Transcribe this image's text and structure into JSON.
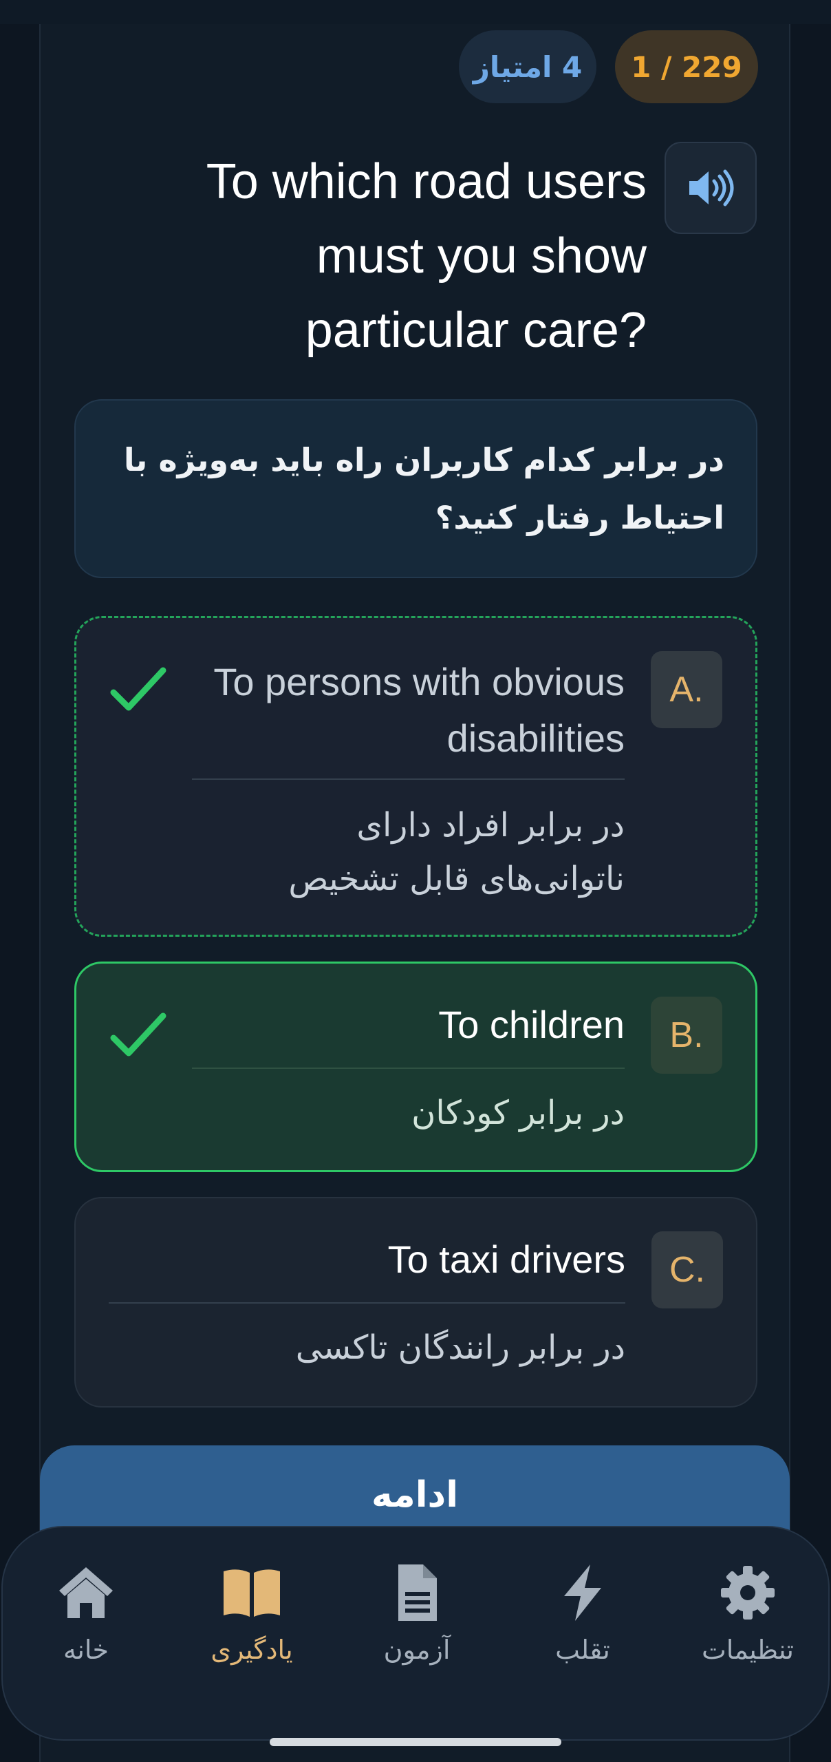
{
  "header": {
    "progress": "1 / 229",
    "score": "4 امتیاز"
  },
  "question": {
    "english": "To which road users must you show particular care?",
    "persian": "در برابر کدام کاربران راه باید به‌ویژه با احتیاط رفتار کنید؟"
  },
  "options": [
    {
      "letter": "A.",
      "english": "To persons with obvious disabilities",
      "persian": "در برابر افراد دارای ناتوانی‌های قابل تشخیص",
      "state": "correct-unselected"
    },
    {
      "letter": "B.",
      "english": "To children",
      "persian": "در برابر کودکان",
      "state": "correct-selected"
    },
    {
      "letter": "C.",
      "english": "To taxi drivers",
      "persian": "در برابر رانندگان تاکسی",
      "state": "neutral"
    }
  ],
  "continue_label": "ادامه",
  "nav": {
    "items": [
      {
        "label": "خانه",
        "icon": "home-icon"
      },
      {
        "label": "یادگیری",
        "icon": "book-icon",
        "active": true
      },
      {
        "label": "آزمون",
        "icon": "document-icon"
      },
      {
        "label": "تقلب",
        "icon": "lightning-icon"
      },
      {
        "label": "تنظیمات",
        "icon": "gear-icon"
      }
    ]
  },
  "colors": {
    "accent_orange": "#f0a731",
    "accent_blue": "#6ea8e6",
    "correct_green": "#2ec866",
    "continue_blue": "#2f5f90",
    "nav_active": "#e3b878"
  }
}
